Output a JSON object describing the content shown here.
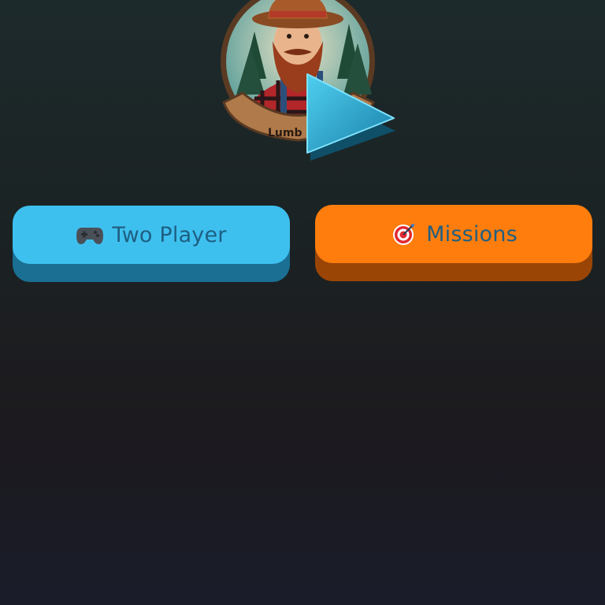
{
  "logo": {
    "banner_text": "Lumb",
    "play_icon": "play-triangle-icon"
  },
  "buttons": {
    "two_player": {
      "label": "Two Player",
      "icon": "gamepad-icon",
      "color": "#3ec0ef",
      "shadow_color": "#1a6f93"
    },
    "missions": {
      "label": "Missions",
      "icon": "target-icon",
      "color": "#ff7d0d",
      "shadow_color": "#9a4506"
    }
  },
  "colors": {
    "label_text": "#1e5f82",
    "background_top": "#1d2a2c",
    "background_bottom": "#1a1c2a"
  }
}
